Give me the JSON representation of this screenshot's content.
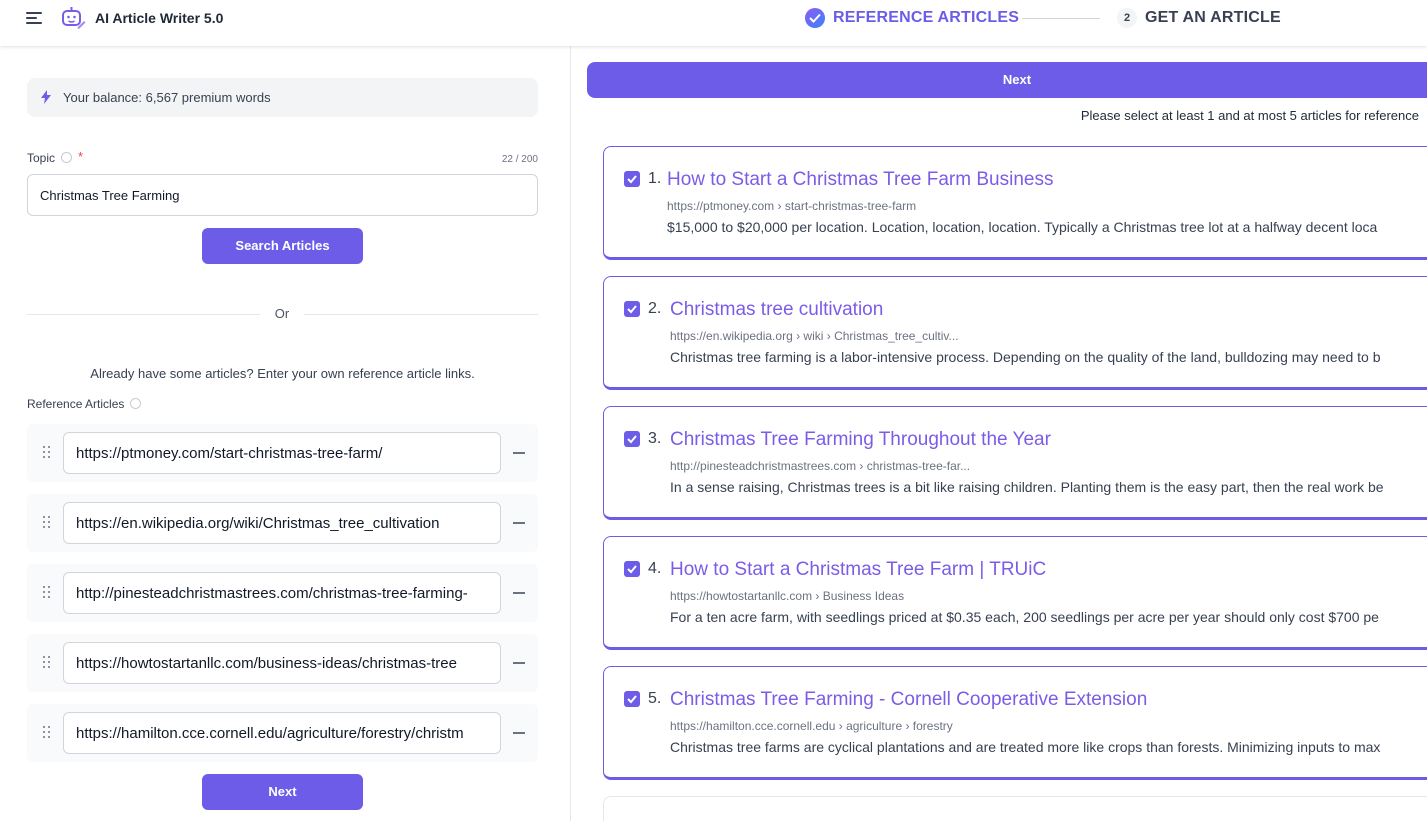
{
  "header": {
    "app_title": "AI Article Writer 5.0",
    "steps": [
      {
        "label": "REFERENCE ARTICLES",
        "state": "done"
      },
      {
        "number": "2",
        "label": "GET AN ARTICLE",
        "state": "pending"
      }
    ]
  },
  "left": {
    "balance": "Your balance: 6,567 premium words",
    "topic": {
      "label": "Topic",
      "required_mark": "*",
      "count": "22 / 200",
      "value": "Christmas Tree Farming"
    },
    "search_button": "Search Articles",
    "or_text": "Or",
    "already_text": "Already have some articles? Enter your own reference article links.",
    "reference_label": "Reference Articles",
    "references": [
      "https://ptmoney.com/start-christmas-tree-farm/",
      "https://en.wikipedia.org/wiki/Christmas_tree_cultivation",
      "http://pinesteadchristmastrees.com/christmas-tree-farming-",
      "https://howtostartanllc.com/business-ideas/christmas-tree",
      "https://hamilton.cce.cornell.edu/agriculture/forestry/christm"
    ],
    "next_button": "Next"
  },
  "right": {
    "next_button": "Next",
    "hint": "Please select at least 1 and at most 5 articles for reference",
    "articles": [
      {
        "num": "1.",
        "checked": true,
        "title": "How to Start a Christmas Tree Farm Business",
        "url": "https://ptmoney.com › start-christmas-tree-farm",
        "snippet": "$15,000 to $20,000 per location. Location, location, location. Typically a Christmas tree lot at a halfway decent loca"
      },
      {
        "num": "2.",
        "checked": true,
        "title": "Christmas tree cultivation",
        "url": "https://en.wikipedia.org › wiki › Christmas_tree_cultiv...",
        "snippet": "Christmas tree farming is a labor-intensive process. Depending on the quality of the land, bulldozing may need to b"
      },
      {
        "num": "3.",
        "checked": true,
        "title": "Christmas Tree Farming Throughout the Year",
        "url": "http://pinesteadchristmastrees.com › christmas-tree-far...",
        "snippet": "In a sense raising, Christmas trees is a bit like raising children. Planting them is the easy part, then the real work be"
      },
      {
        "num": "4.",
        "checked": true,
        "title": "How to Start a Christmas Tree Farm | TRUiC",
        "url": "https://howtostartanllc.com › Business Ideas",
        "snippet": "For a ten acre farm, with seedlings priced at $0.35 each, 200 seedlings per acre per year should only cost $700 pe"
      },
      {
        "num": "5.",
        "checked": true,
        "title": "Christmas Tree Farming - Cornell Cooperative Extension",
        "url": "https://hamilton.cce.cornell.edu › agriculture › forestry",
        "snippet": "Christmas tree farms are cyclical plantations and are treated more like crops than forests. Minimizing inputs to max"
      }
    ]
  },
  "colors": {
    "accent": "#6c5ce7",
    "title_link": "#7c5ce7",
    "required": "#ef4444"
  },
  "icons": [
    "menu-icon",
    "robot-logo-icon",
    "check-circle-icon",
    "bolt-icon",
    "info-icon",
    "drag-handle-icon",
    "minus-icon",
    "checkbox-checked-icon"
  ]
}
